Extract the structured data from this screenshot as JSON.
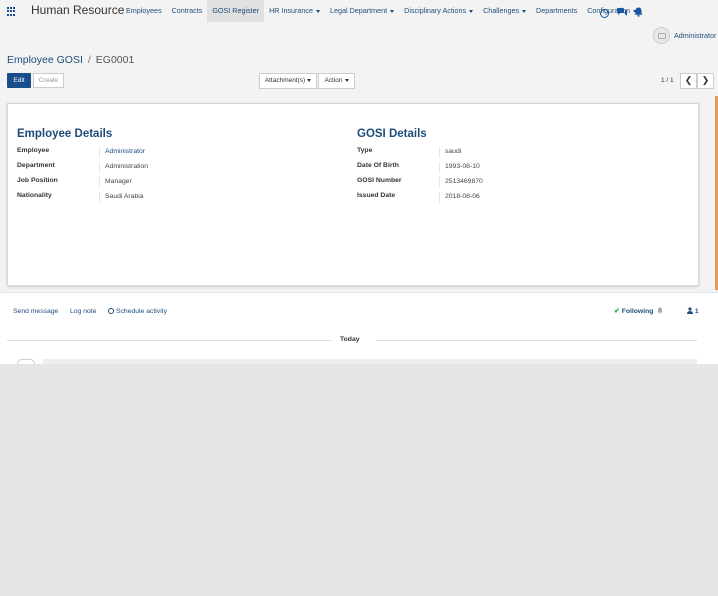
{
  "app": {
    "title": "Human Resource"
  },
  "menu": [
    {
      "label": "Employees",
      "dropdown": false,
      "active": false
    },
    {
      "label": "Contracts",
      "dropdown": false,
      "active": false
    },
    {
      "label": "GOSI Register",
      "dropdown": false,
      "active": true
    },
    {
      "label": "HR Insurance",
      "dropdown": true,
      "active": false
    },
    {
      "label": "Legal Department",
      "dropdown": true,
      "active": false
    },
    {
      "label": "Disciplinary Actions",
      "dropdown": true,
      "active": false
    },
    {
      "label": "Challenges",
      "dropdown": true,
      "active": false
    },
    {
      "label": "Departments",
      "dropdown": false,
      "active": false
    },
    {
      "label": "Configuration",
      "dropdown": true,
      "active": false
    }
  ],
  "systray": {
    "user": "Administrator",
    "icons": [
      "clock-icon",
      "chat-icon",
      "bell-icon"
    ]
  },
  "breadcrumb": {
    "parent": "Employee GOSI",
    "separator": "/",
    "current": "EG0001"
  },
  "buttons": {
    "edit": "Edit",
    "create": "Create",
    "attachments": "Attachment(s)",
    "action": "Action"
  },
  "pager": {
    "value": "1 / 1",
    "prev": "❮",
    "next": "❯"
  },
  "form": {
    "employee_details": {
      "title": "Employee Details",
      "fields": [
        {
          "label": "Employee",
          "value": "Administrator",
          "link": true
        },
        {
          "label": "Department",
          "value": "Administration",
          "link": false
        },
        {
          "label": "Job Position",
          "value": "Manager",
          "link": false
        },
        {
          "label": "Nationality",
          "value": "Saudi Arabia",
          "link": false
        }
      ]
    },
    "gosi_details": {
      "title": "GOSI Details",
      "fields": [
        {
          "label": "Type",
          "value": "saudi"
        },
        {
          "label": "Date Of Birth",
          "value": "1993-08-10"
        },
        {
          "label": "GOSI Number",
          "value": "2513469870"
        },
        {
          "label": "Issued Date",
          "value": "2018-08-06"
        }
      ]
    }
  },
  "chatter": {
    "send_message": "Send message",
    "log_note": "Log note",
    "schedule_activity": "Schedule activity",
    "following": "Following",
    "followers_count": "1",
    "date_separator": "Today"
  },
  "colors": {
    "brand": "#1a4e8a",
    "link": "#1e4c7a",
    "accent_border": "#e69a5a",
    "following_check": "#28a745"
  }
}
